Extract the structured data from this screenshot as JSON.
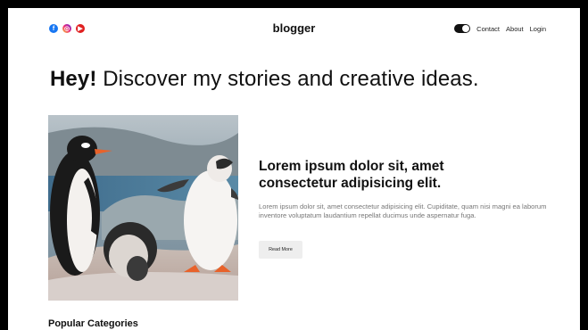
{
  "header": {
    "brand": "blogger",
    "socials": [
      {
        "icon": "facebook-icon",
        "glyph": "f",
        "color": "#1877f2"
      },
      {
        "icon": "instagram-icon",
        "glyph": "◎",
        "color": "#e1306c"
      },
      {
        "icon": "youtube-icon",
        "glyph": "▶",
        "color": "#e02020"
      }
    ],
    "theme_toggle": {
      "icon": "dark-mode-toggle",
      "state": "dark"
    },
    "links": [
      "Contact",
      "About",
      "Login"
    ]
  },
  "hero": {
    "greeting": "Hey!",
    "tagline": "Discover my stories and creative ideas."
  },
  "featured_post": {
    "image_icon": "penguins-photo",
    "title": "Lorem ipsum dolor sit, amet consectetur adipisicing elit.",
    "description": "Lorem ipsum dolor sit, amet consectetur adipisicing elit. Cupiditate, quam nisi magni ea laborum inventore voluptatum laudantium repellat ducimus unde aspernatur fuga.",
    "button_label": "Read More"
  },
  "sections": {
    "popular_categories": "Popular Categories"
  }
}
